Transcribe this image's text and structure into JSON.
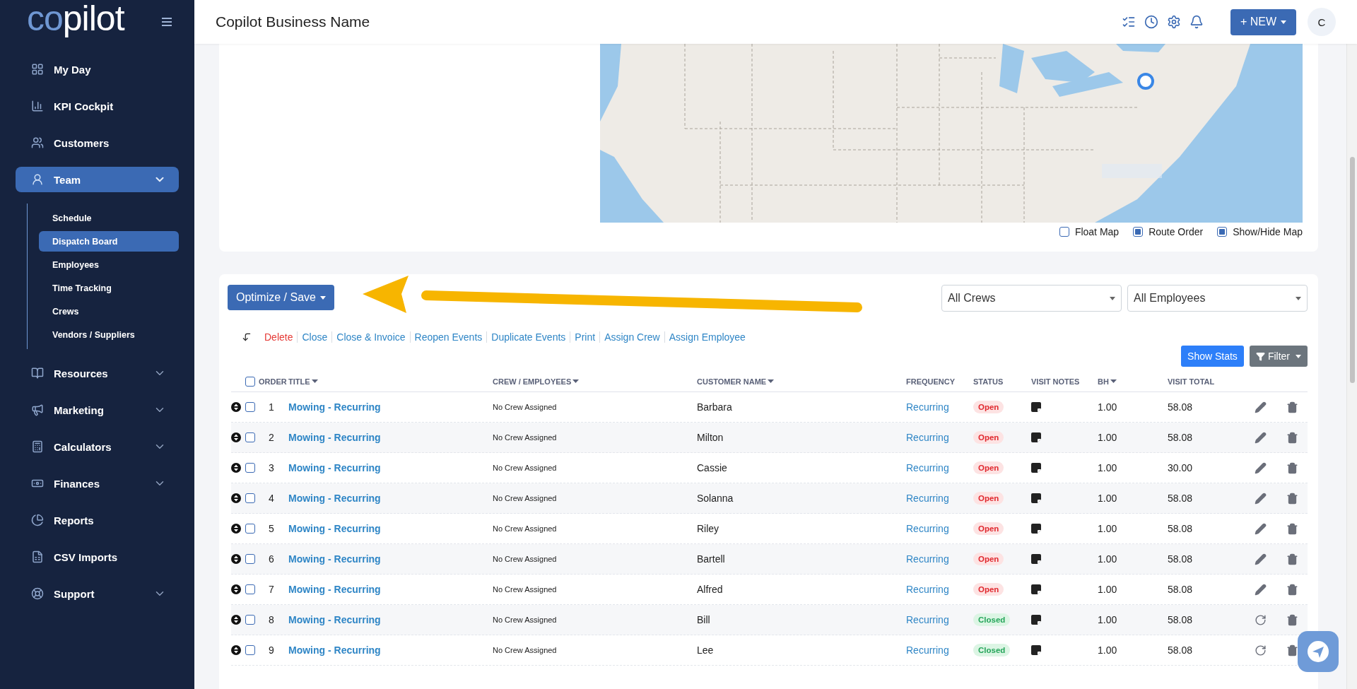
{
  "logo": {
    "accent": "co",
    "rest": "pilot"
  },
  "sidebar": {
    "items": [
      {
        "label": "My Day",
        "selected": false
      },
      {
        "label": "KPI Cockpit",
        "selected": false
      },
      {
        "label": "Customers",
        "selected": false
      },
      {
        "label": "Team",
        "selected": true,
        "expanded": true,
        "children": [
          {
            "label": "Schedule",
            "selected": false
          },
          {
            "label": "Dispatch Board",
            "selected": true
          },
          {
            "label": "Employees",
            "selected": false
          },
          {
            "label": "Time Tracking",
            "selected": false
          },
          {
            "label": "Crews",
            "selected": false
          },
          {
            "label": "Vendors / Suppliers",
            "selected": false
          }
        ]
      },
      {
        "label": "Resources",
        "selected": false,
        "expanded": false
      },
      {
        "label": "Marketing",
        "selected": false,
        "expanded": false
      },
      {
        "label": "Calculators",
        "selected": false,
        "expanded": false
      },
      {
        "label": "Finances",
        "selected": false,
        "expanded": false
      },
      {
        "label": "Reports",
        "selected": false
      },
      {
        "label": "CSV Imports",
        "selected": false
      },
      {
        "label": "Support",
        "selected": false,
        "expanded": false
      }
    ]
  },
  "header": {
    "title": "Copilot Business Name",
    "new_button": "+ NEW",
    "avatar": "C"
  },
  "map": {
    "kind": "picture",
    "options": [
      {
        "label": "Float Map",
        "checked": false
      },
      {
        "label": "Route Order",
        "checked": true
      },
      {
        "label": "Show/Hide Map",
        "checked": true
      }
    ]
  },
  "board": {
    "optimize_button": "Optimize / Save",
    "crew_select": {
      "value": "All Crews"
    },
    "employee_select": {
      "value": "All Employees"
    },
    "actions": [
      {
        "label": "Delete",
        "kind": "danger"
      },
      {
        "label": "Close",
        "kind": "link"
      },
      {
        "label": "Close & Invoice",
        "kind": "link"
      },
      {
        "label": "Reopen Events",
        "kind": "link"
      },
      {
        "label": "Duplicate Events",
        "kind": "link"
      },
      {
        "label": "Print",
        "kind": "link"
      },
      {
        "label": "Assign Crew",
        "kind": "link"
      },
      {
        "label": "Assign Employee",
        "kind": "link"
      }
    ],
    "show_stats_button": "Show Stats",
    "filter_button": "Filter",
    "table": {
      "select_all": {
        "checked": false
      },
      "columns": [
        {
          "label": "ORDER",
          "sortable": false
        },
        {
          "label": "TITLE",
          "sortable": true
        },
        {
          "label": "CREW / EMPLOYEES",
          "sortable": true
        },
        {
          "label": "CUSTOMER NAME",
          "sortable": true
        },
        {
          "label": "FREQUENCY",
          "sortable": false
        },
        {
          "label": "STATUS",
          "sortable": false
        },
        {
          "label": "VISIT NOTES",
          "sortable": false
        },
        {
          "label": "BH",
          "sortable": true
        },
        {
          "label": "VISIT TOTAL",
          "sortable": false
        }
      ],
      "rows": [
        {
          "order": "1",
          "title": "Mowing - Recurring",
          "crew": "No Crew Assigned",
          "customer": "Barbara",
          "frequency": "Recurring",
          "status": "Open",
          "kind": "open",
          "bh": "1.00",
          "total": "58.08",
          "checked": false
        },
        {
          "order": "2",
          "title": "Mowing - Recurring",
          "crew": "No Crew Assigned",
          "customer": "Milton",
          "frequency": "Recurring",
          "status": "Open",
          "kind": "open",
          "bh": "1.00",
          "total": "58.08",
          "checked": false
        },
        {
          "order": "3",
          "title": "Mowing - Recurring",
          "crew": "No Crew Assigned",
          "customer": "Cassie",
          "frequency": "Recurring",
          "status": "Open",
          "kind": "open",
          "bh": "1.00",
          "total": "30.00",
          "checked": false
        },
        {
          "order": "4",
          "title": "Mowing - Recurring",
          "crew": "No Crew Assigned",
          "customer": "Solanna",
          "frequency": "Recurring",
          "status": "Open",
          "kind": "open",
          "bh": "1.00",
          "total": "58.08",
          "checked": false
        },
        {
          "order": "5",
          "title": "Mowing - Recurring",
          "crew": "No Crew Assigned",
          "customer": "Riley",
          "frequency": "Recurring",
          "status": "Open",
          "kind": "open",
          "bh": "1.00",
          "total": "58.08",
          "checked": false
        },
        {
          "order": "6",
          "title": "Mowing - Recurring",
          "crew": "No Crew Assigned",
          "customer": "Bartell",
          "frequency": "Recurring",
          "status": "Open",
          "kind": "open",
          "bh": "1.00",
          "total": "58.08",
          "checked": false
        },
        {
          "order": "7",
          "title": "Mowing - Recurring",
          "crew": "No Crew Assigned",
          "customer": "Alfred",
          "frequency": "Recurring",
          "status": "Open",
          "kind": "open",
          "bh": "1.00",
          "total": "58.08",
          "checked": false
        },
        {
          "order": "8",
          "title": "Mowing - Recurring",
          "crew": "No Crew Assigned",
          "customer": "Bill",
          "frequency": "Recurring",
          "status": "Closed",
          "kind": "closed",
          "bh": "1.00",
          "total": "58.08",
          "checked": false
        },
        {
          "order": "9",
          "title": "Mowing - Recurring",
          "crew": "No Crew Assigned",
          "customer": "Lee",
          "frequency": "Recurring",
          "status": "Closed",
          "kind": "closed",
          "bh": "1.00",
          "total": "58.08",
          "checked": false
        }
      ]
    }
  }
}
